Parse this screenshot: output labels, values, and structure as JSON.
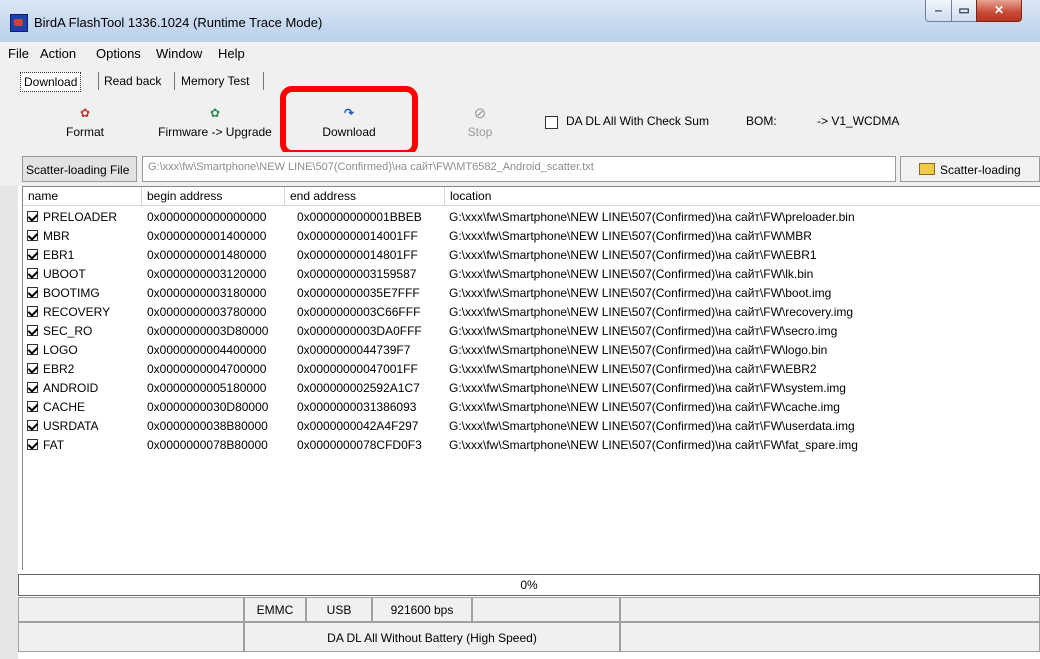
{
  "window": {
    "title": "BirdA FlashTool 1336.1024 (Runtime Trace Mode)",
    "min": "‒",
    "max": "▭",
    "close": "✕"
  },
  "menu": [
    "File",
    "Action",
    "Options",
    "Window",
    "Help"
  ],
  "tabs": [
    "Download",
    "Read back",
    "Memory Test"
  ],
  "toolbar": {
    "format": "Format",
    "firmware_upgrade": "Firmware -> Upgrade",
    "download": "Download",
    "stop": "Stop",
    "checksum_label": "DA DL All With Check Sum",
    "bom_label": "BOM:",
    "bom_value": "-> V1_WCDMA"
  },
  "scatter": {
    "label": "Scatter-loading File",
    "path": "G:\\xxx\\fw\\Smartphone\\NEW LINE\\507(Confirmed)\\на сайт\\FW\\MT6582_Android_scatter.txt",
    "button": "Scatter-loading"
  },
  "table": {
    "headers": [
      "name",
      "begin address",
      "end address",
      "location"
    ],
    "rows": [
      {
        "name": "PRELOADER",
        "begin": "0x0000000000000000",
        "end": "0x000000000001BBEB",
        "location": "G:\\xxx\\fw\\Smartphone\\NEW LINE\\507(Confirmed)\\на сайт\\FW\\preloader.bin"
      },
      {
        "name": "MBR",
        "begin": "0x0000000001400000",
        "end": "0x00000000014001FF",
        "location": "G:\\xxx\\fw\\Smartphone\\NEW LINE\\507(Confirmed)\\на сайт\\FW\\MBR"
      },
      {
        "name": "EBR1",
        "begin": "0x0000000001480000",
        "end": "0x00000000014801FF",
        "location": "G:\\xxx\\fw\\Smartphone\\NEW LINE\\507(Confirmed)\\на сайт\\FW\\EBR1"
      },
      {
        "name": "UBOOT",
        "begin": "0x0000000003120000",
        "end": "0x0000000003159587",
        "location": "G:\\xxx\\fw\\Smartphone\\NEW LINE\\507(Confirmed)\\на сайт\\FW\\lk.bin"
      },
      {
        "name": "BOOTIMG",
        "begin": "0x0000000003180000",
        "end": "0x00000000035E7FFF",
        "location": "G:\\xxx\\fw\\Smartphone\\NEW LINE\\507(Confirmed)\\на сайт\\FW\\boot.img"
      },
      {
        "name": "RECOVERY",
        "begin": "0x0000000003780000",
        "end": "0x0000000003C66FFF",
        "location": "G:\\xxx\\fw\\Smartphone\\NEW LINE\\507(Confirmed)\\на сайт\\FW\\recovery.img"
      },
      {
        "name": "SEC_RO",
        "begin": "0x0000000003D80000",
        "end": "0x0000000003DA0FFF",
        "location": "G:\\xxx\\fw\\Smartphone\\NEW LINE\\507(Confirmed)\\на сайт\\FW\\secro.img"
      },
      {
        "name": "LOGO",
        "begin": "0x0000000004400000",
        "end": "0x0000000044739F7",
        "location": "G:\\xxx\\fw\\Smartphone\\NEW LINE\\507(Confirmed)\\на сайт\\FW\\logo.bin"
      },
      {
        "name": "EBR2",
        "begin": "0x0000000004700000",
        "end": "0x00000000047001FF",
        "location": "G:\\xxx\\fw\\Smartphone\\NEW LINE\\507(Confirmed)\\на сайт\\FW\\EBR2"
      },
      {
        "name": "ANDROID",
        "begin": "0x0000000005180000",
        "end": "0x000000002592A1C7",
        "location": "G:\\xxx\\fw\\Smartphone\\NEW LINE\\507(Confirmed)\\на сайт\\FW\\system.img"
      },
      {
        "name": "CACHE",
        "begin": "0x0000000030D80000",
        "end": "0x0000000031386093",
        "location": "G:\\xxx\\fw\\Smartphone\\NEW LINE\\507(Confirmed)\\на сайт\\FW\\cache.img"
      },
      {
        "name": "USRDATA",
        "begin": "0x0000000038B80000",
        "end": "0x0000000042A4F297",
        "location": "G:\\xxx\\fw\\Smartphone\\NEW LINE\\507(Confirmed)\\на сайт\\FW\\userdata.img"
      },
      {
        "name": "FAT",
        "begin": "0x0000000078B80000",
        "end": "0x0000000078CFD0F3",
        "location": "G:\\xxx\\fw\\Smartphone\\NEW LINE\\507(Confirmed)\\на сайт\\FW\\fat_spare.img"
      }
    ]
  },
  "progress": {
    "text": "0%",
    "value": 0
  },
  "status": {
    "storage": "EMMC",
    "port": "USB",
    "baud": "921600 bps",
    "mode": "DA DL All Without Battery (High Speed)"
  },
  "icons": [
    "format-icon",
    "firmware-upgrade-icon",
    "download-icon",
    "stop-icon",
    "folder-icon",
    "app-icon"
  ],
  "colors": {
    "highlight": "#ff0000",
    "close_button": "#c74a35"
  }
}
